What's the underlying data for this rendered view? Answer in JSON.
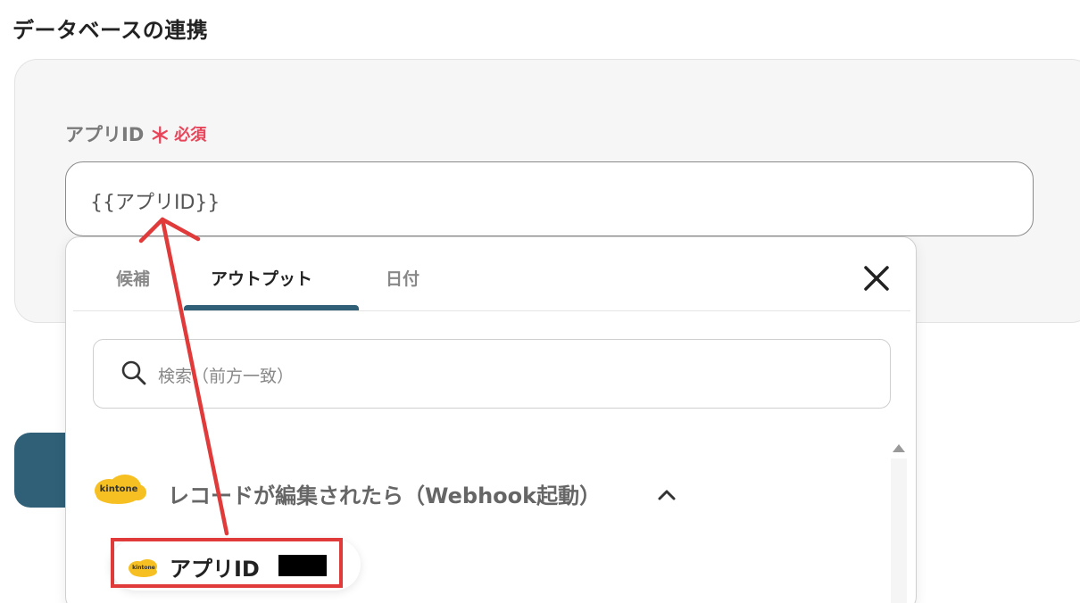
{
  "section": {
    "title": "データベースの連携"
  },
  "field": {
    "label": "アプリID",
    "required_star": "＊",
    "required_text": "必須",
    "value": "{{アプリID}}"
  },
  "popup": {
    "tabs": [
      {
        "label": "候補",
        "active": false
      },
      {
        "label": "アウトプット",
        "active": true
      },
      {
        "label": "日付",
        "active": false
      }
    ],
    "search_placeholder": "検索（前方一致）",
    "group": {
      "logo_text": "kintone",
      "label": "レコードが編集されたら（Webhook起動）",
      "expanded": true
    },
    "items": [
      {
        "label": "アプリID",
        "logo_text": "kintone"
      }
    ]
  },
  "colors": {
    "accent": "#2f6077",
    "required": "#e8455b",
    "annotation": "#e03a3a",
    "kintone": "#f6c022"
  },
  "icons": {
    "close": "close-icon",
    "search": "search-icon",
    "chevron": "chevron-up-icon",
    "scroll": "scroll-up-arrow-icon"
  }
}
